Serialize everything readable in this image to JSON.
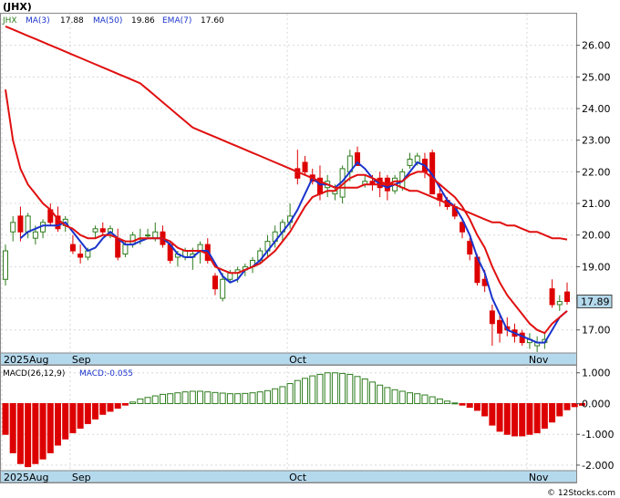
{
  "header": {
    "symbol": "(JHX)",
    "ticker": "JHX",
    "ma3_label": "MA(3)",
    "ma3_value": "17.88",
    "ma50_label": "MA(50)",
    "ma50_value": "19.86",
    "ema7_label": "EMA(7)",
    "ema7_value": "17.60",
    "last_price_tag": "17.89"
  },
  "macd_header": {
    "label": "MACD(26,12,9)",
    "value_label": "MACD:-0.055"
  },
  "footer": {
    "credit": "© 12Stocks.com"
  },
  "colors": {
    "up": "#2e7d1e",
    "down": "#dd0000",
    "ma_short": "#1a33cc",
    "ma_long": "#e01010",
    "axis_band": "#b5d9ec",
    "tag": "#b5d9ec"
  },
  "chart_data": [
    {
      "type": "candlestick",
      "ticker": "JHX",
      "x_labels": [
        {
          "index": 0,
          "text": "2025Aug"
        },
        {
          "index": 9,
          "text": "Sep"
        },
        {
          "index": 38,
          "text": "Oct"
        },
        {
          "index": 70,
          "text": "Nov"
        }
      ],
      "ylim": [
        16.3,
        27.0
      ],
      "y_ticks": [
        17.0,
        18.0,
        19.0,
        20.0,
        21.0,
        22.0,
        23.0,
        24.0,
        25.0,
        26.0
      ],
      "y_tick_labels": [
        "17.00",
        "18.00",
        "19.00",
        "20.00",
        "21.00",
        "22.00",
        "23.00",
        "24.00",
        "25.00",
        "26.00"
      ],
      "ohlc": [
        [
          18.6,
          19.7,
          18.4,
          19.5
        ],
        [
          20.1,
          20.6,
          19.8,
          20.4
        ],
        [
          20.6,
          20.9,
          19.8,
          20.1
        ],
        [
          20.1,
          20.7,
          19.9,
          20.6
        ],
        [
          19.9,
          20.3,
          19.7,
          20.1
        ],
        [
          20.1,
          20.5,
          19.9,
          20.4
        ],
        [
          20.8,
          21.0,
          20.3,
          20.4
        ],
        [
          20.6,
          20.9,
          20.1,
          20.2
        ],
        [
          20.3,
          20.6,
          20.1,
          20.5
        ],
        [
          19.7,
          20.0,
          19.4,
          19.5
        ],
        [
          19.4,
          19.7,
          19.1,
          19.3
        ],
        [
          19.3,
          19.6,
          19.2,
          19.5
        ],
        [
          20.1,
          20.3,
          19.9,
          20.2
        ],
        [
          20.2,
          20.4,
          20.0,
          20.1
        ],
        [
          20.1,
          20.3,
          19.9,
          20.2
        ],
        [
          19.9,
          20.2,
          19.2,
          19.3
        ],
        [
          19.4,
          19.8,
          19.3,
          19.7
        ],
        [
          19.7,
          20.1,
          19.6,
          20.0
        ],
        [
          19.9,
          20.2,
          19.7,
          19.9
        ],
        [
          20.0,
          20.2,
          19.9,
          20.0
        ],
        [
          19.9,
          20.4,
          19.8,
          20.1
        ],
        [
          20.1,
          20.3,
          19.6,
          19.7
        ],
        [
          19.7,
          19.8,
          19.1,
          19.2
        ],
        [
          19.3,
          19.5,
          19.0,
          19.4
        ],
        [
          19.3,
          19.6,
          19.2,
          19.5
        ],
        [
          19.3,
          19.6,
          18.9,
          19.4
        ],
        [
          19.5,
          19.8,
          19.1,
          19.7
        ],
        [
          19.7,
          19.9,
          19.1,
          19.2
        ],
        [
          18.7,
          18.8,
          18.1,
          18.3
        ],
        [
          18.0,
          18.8,
          17.9,
          18.6
        ],
        [
          18.6,
          18.9,
          18.5,
          18.8
        ],
        [
          18.8,
          19.0,
          18.5,
          18.9
        ],
        [
          18.9,
          19.1,
          18.7,
          19.0
        ],
        [
          19.0,
          19.3,
          18.8,
          19.2
        ],
        [
          19.2,
          19.6,
          19.1,
          19.5
        ],
        [
          19.5,
          20.0,
          19.3,
          19.8
        ],
        [
          19.8,
          20.3,
          19.6,
          20.1
        ],
        [
          20.1,
          20.5,
          19.8,
          20.4
        ],
        [
          20.4,
          21.0,
          20.2,
          20.6
        ],
        [
          22.1,
          22.7,
          21.6,
          21.8
        ],
        [
          22.3,
          22.5,
          21.9,
          22.0
        ],
        [
          21.9,
          22.1,
          21.6,
          21.7
        ],
        [
          21.8,
          22.2,
          21.1,
          21.3
        ],
        [
          21.5,
          21.9,
          21.2,
          21.7
        ],
        [
          21.3,
          21.6,
          21.1,
          21.4
        ],
        [
          21.2,
          22.2,
          21.0,
          22.1
        ],
        [
          22.0,
          22.7,
          21.7,
          22.5
        ],
        [
          22.6,
          22.8,
          22.3,
          22.2
        ],
        [
          21.6,
          21.9,
          21.5,
          21.7
        ],
        [
          21.7,
          21.9,
          21.4,
          21.6
        ],
        [
          21.8,
          22.0,
          21.2,
          21.5
        ],
        [
          21.8,
          21.9,
          21.1,
          21.4
        ],
        [
          21.4,
          21.9,
          21.3,
          21.8
        ],
        [
          21.5,
          22.1,
          21.4,
          22.0
        ],
        [
          22.2,
          22.6,
          22.1,
          22.4
        ],
        [
          22.3,
          22.6,
          22.2,
          22.5
        ],
        [
          22.4,
          22.6,
          21.8,
          22.0
        ],
        [
          22.6,
          22.7,
          21.9,
          21.3
        ],
        [
          21.3,
          21.6,
          20.9,
          21.1
        ],
        [
          21.1,
          21.2,
          20.8,
          20.9
        ],
        [
          20.9,
          21.0,
          20.5,
          20.6
        ],
        [
          20.4,
          20.5,
          19.9,
          20.1
        ],
        [
          19.8,
          19.9,
          19.2,
          19.4
        ],
        [
          19.3,
          19.4,
          18.4,
          18.5
        ],
        [
          18.6,
          18.9,
          18.2,
          18.4
        ],
        [
          17.6,
          17.8,
          16.5,
          17.2
        ],
        [
          17.3,
          17.5,
          16.6,
          16.9
        ],
        [
          17.1,
          17.4,
          16.8,
          17.0
        ],
        [
          17.0,
          17.2,
          16.6,
          16.8
        ],
        [
          16.9,
          17.0,
          16.5,
          16.6
        ],
        [
          16.6,
          16.9,
          16.4,
          16.7
        ],
        [
          16.5,
          16.8,
          16.3,
          16.6
        ],
        [
          16.6,
          16.9,
          16.4,
          16.7
        ],
        [
          18.3,
          18.6,
          17.7,
          17.8
        ],
        [
          17.8,
          18.1,
          17.6,
          17.9
        ],
        [
          18.2,
          18.5,
          17.8,
          17.9
        ]
      ],
      "series": [
        {
          "name": "MA(3)",
          "color": "#1a33cc",
          "values": [
            null,
            null,
            19.9,
            20.1,
            20.2,
            20.3,
            20.3,
            20.3,
            20.4,
            20.1,
            19.8,
            19.5,
            19.6,
            19.9,
            20.1,
            19.9,
            19.7,
            19.7,
            19.8,
            19.9,
            19.9,
            19.9,
            19.7,
            19.4,
            19.3,
            19.3,
            19.5,
            19.5,
            19.1,
            18.7,
            18.5,
            18.6,
            18.9,
            19.0,
            19.2,
            19.5,
            19.8,
            20.1,
            20.4,
            20.8,
            21.3,
            21.8,
            21.6,
            21.6,
            21.5,
            21.7,
            22.0,
            22.3,
            22.1,
            21.8,
            21.6,
            21.5,
            21.6,
            21.7,
            22.0,
            22.3,
            22.2,
            21.9,
            21.5,
            21.1,
            20.9,
            20.5,
            20.0,
            19.3,
            18.8,
            18.0,
            17.5,
            17.0,
            16.9,
            16.8,
            16.7,
            16.6,
            16.6,
            17.0,
            17.4,
            17.6
          ]
        },
        {
          "name": "MA(50)",
          "color": "#e01010",
          "values": [
            26.6,
            26.5,
            26.4,
            26.3,
            26.2,
            26.1,
            26.0,
            25.9,
            25.8,
            25.7,
            25.6,
            25.5,
            25.4,
            25.3,
            25.2,
            25.1,
            25.0,
            24.9,
            24.8,
            24.6,
            24.4,
            24.2,
            24.0,
            23.8,
            23.6,
            23.4,
            23.3,
            23.2,
            23.1,
            23.0,
            22.9,
            22.8,
            22.7,
            22.6,
            22.5,
            22.4,
            22.3,
            22.2,
            22.1,
            22.0,
            21.9,
            21.8,
            21.7,
            21.6,
            21.5,
            21.5,
            21.5,
            21.5,
            21.6,
            21.6,
            21.6,
            21.6,
            21.6,
            21.5,
            21.4,
            21.4,
            21.3,
            21.2,
            21.1,
            21.0,
            20.9,
            20.8,
            20.7,
            20.6,
            20.5,
            20.4,
            20.4,
            20.3,
            20.3,
            20.2,
            20.1,
            20.1,
            20.0,
            19.9,
            19.9,
            19.86
          ]
        },
        {
          "name": "EMA(7)",
          "color": "#e01010",
          "values": [
            24.6,
            23.0,
            22.1,
            21.6,
            21.3,
            21.0,
            20.8,
            20.5,
            20.3,
            20.2,
            20.0,
            19.9,
            19.9,
            20.0,
            20.0,
            19.9,
            19.8,
            19.8,
            19.9,
            19.9,
            19.9,
            19.9,
            19.8,
            19.6,
            19.5,
            19.5,
            19.5,
            19.4,
            19.0,
            18.9,
            18.8,
            18.8,
            18.9,
            19.0,
            19.1,
            19.3,
            19.5,
            19.8,
            20.1,
            20.5,
            20.9,
            21.2,
            21.3,
            21.4,
            21.4,
            21.6,
            21.8,
            21.9,
            21.9,
            21.8,
            21.7,
            21.6,
            21.7,
            21.7,
            21.9,
            22.0,
            22.0,
            21.8,
            21.6,
            21.4,
            21.2,
            20.9,
            20.5,
            20.0,
            19.6,
            19.0,
            18.5,
            18.1,
            17.8,
            17.5,
            17.2,
            17.0,
            16.9,
            17.2,
            17.4,
            17.6
          ]
        }
      ]
    },
    {
      "type": "bar",
      "title": "MACD(26,12,9)",
      "ylim": [
        -2.15,
        1.2
      ],
      "y_ticks": [
        1.0,
        0.0,
        -1.0,
        -2.0
      ],
      "y_tick_labels": [
        "1.000",
        "0.000",
        "-1.000",
        "-2.000"
      ],
      "values": [
        -1.0,
        -1.6,
        -1.95,
        -2.05,
        -1.95,
        -1.8,
        -1.6,
        -1.35,
        -1.15,
        -0.95,
        -0.8,
        -0.65,
        -0.5,
        -0.35,
        -0.25,
        -0.15,
        -0.05,
        0.05,
        0.15,
        0.2,
        0.25,
        0.3,
        0.32,
        0.35,
        0.38,
        0.4,
        0.4,
        0.38,
        0.36,
        0.34,
        0.32,
        0.32,
        0.33,
        0.35,
        0.38,
        0.42,
        0.48,
        0.55,
        0.65,
        0.75,
        0.82,
        0.9,
        0.95,
        1.0,
        1.0,
        0.98,
        0.95,
        0.88,
        0.8,
        0.7,
        0.6,
        0.52,
        0.45,
        0.4,
        0.35,
        0.32,
        0.28,
        0.22,
        0.15,
        0.08,
        0.02,
        -0.05,
        -0.12,
        -0.22,
        -0.4,
        -0.7,
        -0.9,
        -1.0,
        -1.05,
        -1.05,
        -1.0,
        -0.95,
        -0.8,
        -0.6,
        -0.4,
        -0.2,
        -0.1,
        -0.055
      ]
    }
  ]
}
